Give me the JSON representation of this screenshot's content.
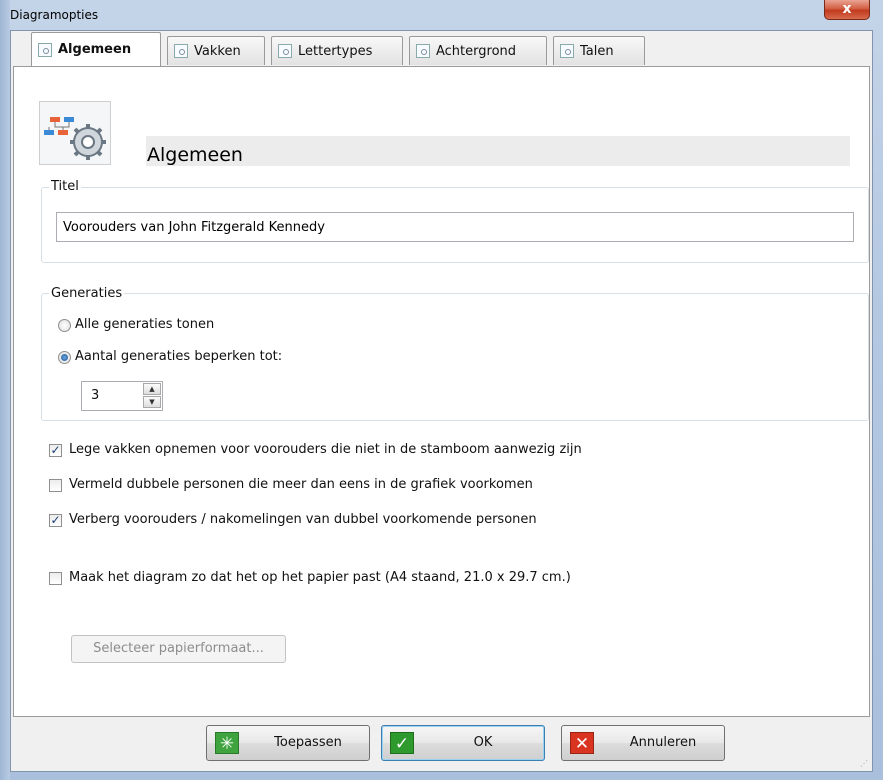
{
  "window": {
    "title": "Diagramopties",
    "close_symbol": "x"
  },
  "tabs": [
    {
      "label": "Algemeen",
      "active": true
    },
    {
      "label": "Vakken",
      "active": false
    },
    {
      "label": "Lettertypes",
      "active": false
    },
    {
      "label": "Achtergrond",
      "active": false
    },
    {
      "label": "Talen",
      "active": false
    }
  ],
  "header": {
    "title": "Algemeen",
    "icon": "diagram-settings-icon"
  },
  "titel": {
    "legend": "Titel",
    "value": "Voorouders van John Fitzgerald Kennedy"
  },
  "generaties": {
    "legend": "Generaties",
    "option_all": "Alle generaties tonen",
    "option_limit": "Aantal generaties beperken tot:",
    "selected": "limit",
    "count": "3"
  },
  "options": {
    "empty_boxes": {
      "label": "Lege vakken opnemen voor voorouders die niet in de stamboom aanwezig zijn",
      "checked": true
    },
    "duplicates": {
      "label": "Vermeld dubbele personen die meer dan eens in de grafiek voorkomen",
      "checked": false
    },
    "hide_duplicates": {
      "label": "Verberg voorouders / nakomelingen van dubbel voorkomende personen",
      "checked": true
    },
    "fit_paper": {
      "label": "Maak het diagram zo dat het op het papier past (A4 staand, 21.0 x 29.7 cm.)",
      "checked": false
    },
    "select_paper_button": "Selecteer papierformaat..."
  },
  "buttons": {
    "apply": "Toepassen",
    "ok": "OK",
    "cancel": "Annuleren"
  },
  "colors": {
    "apply_icon": "#3fa33f",
    "ok_icon": "#2e9a2e",
    "cancel_icon": "#d8341f",
    "frame": "#b4c8e2"
  }
}
